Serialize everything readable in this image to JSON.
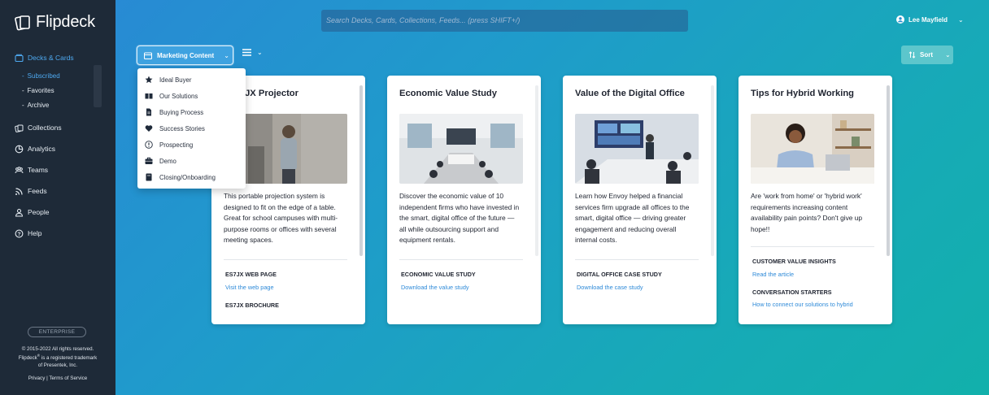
{
  "app": {
    "name": "Flipdeck"
  },
  "sidebar": {
    "items": [
      {
        "label": "Decks & Cards",
        "icon": "decks-icon"
      },
      {
        "label": "Collections",
        "icon": "collections-icon"
      },
      {
        "label": "Analytics",
        "icon": "analytics-icon"
      },
      {
        "label": "Teams",
        "icon": "teams-icon"
      },
      {
        "label": "Feeds",
        "icon": "feeds-icon"
      },
      {
        "label": "People",
        "icon": "people-icon"
      },
      {
        "label": "Help",
        "icon": "help-icon"
      }
    ],
    "subitems": [
      "Subscribed",
      "Favorites",
      "Archive"
    ],
    "badge": "ENTERPRISE",
    "legal": {
      "line1": "© 2015-2022 All rights reserved.",
      "line2_a": "Flipdeck",
      "line2_sup": "®",
      "line2_b": " is a registered trademark",
      "line3": "of Presentek, Inc.",
      "privacy": "Privacy",
      "separator": " | ",
      "terms": "Terms of Service"
    },
    "accent_color": "#4ea9f0"
  },
  "header": {
    "search_placeholder": "Search Decks, Cards, Collections, Feeds...   (press SHIFT+/)",
    "user_name": "Lee Mayfield"
  },
  "toolbar": {
    "deck_selector": "Marketing Content",
    "sort_label": "Sort"
  },
  "dropdown": {
    "items": [
      {
        "label": "Ideal Buyer",
        "icon": "star-icon"
      },
      {
        "label": "Our Solutions",
        "icon": "book-icon"
      },
      {
        "label": "Buying Process",
        "icon": "document-icon"
      },
      {
        "label": "Success Stories",
        "icon": "heart-icon"
      },
      {
        "label": "Prospecting",
        "icon": "alert-icon"
      },
      {
        "label": "Demo",
        "icon": "briefcase-icon"
      },
      {
        "label": "Closing/Onboarding",
        "icon": "notebook-icon"
      }
    ]
  },
  "cards": [
    {
      "title": "Z ES7JX Projector",
      "description": "This portable projection system is designed to fit on the edge of a table. Great for school campuses with multi-purpose rooms or offices with several meeting spaces.",
      "sections": [
        {
          "label": "ES7JX WEB PAGE",
          "link": "Visit the web page"
        },
        {
          "label": "ES7JX BROCHURE",
          "link": ""
        }
      ]
    },
    {
      "title": "Economic Value Study",
      "description": "Discover the economic value of 10 independent firms who have invested in the smart, digital office of the future — all while outsourcing support and equipment rentals.",
      "sections": [
        {
          "label": "ECONOMIC VALUE STUDY",
          "link": "Download the value study"
        }
      ]
    },
    {
      "title": "Value of the Digital Office",
      "description": "Learn how Envoy helped a financial services firm upgrade all offices to the smart, digital office — driving greater engagement and reducing overall internal costs.",
      "sections": [
        {
          "label": "DIGITAL OFFICE CASE STUDY",
          "link": "Download the case study"
        }
      ]
    },
    {
      "title": "Tips for Hybrid Working",
      "description": "Are 'work from home' or 'hybrid work' requirements increasing content availability pain points? Don't give up hope!!",
      "sections": [
        {
          "label": "CUSTOMER VALUE INSIGHTS",
          "link": "Read the article"
        },
        {
          "label": "CONVERSATION STARTERS",
          "link": "How to connect our solutions to hybrid"
        }
      ]
    }
  ]
}
